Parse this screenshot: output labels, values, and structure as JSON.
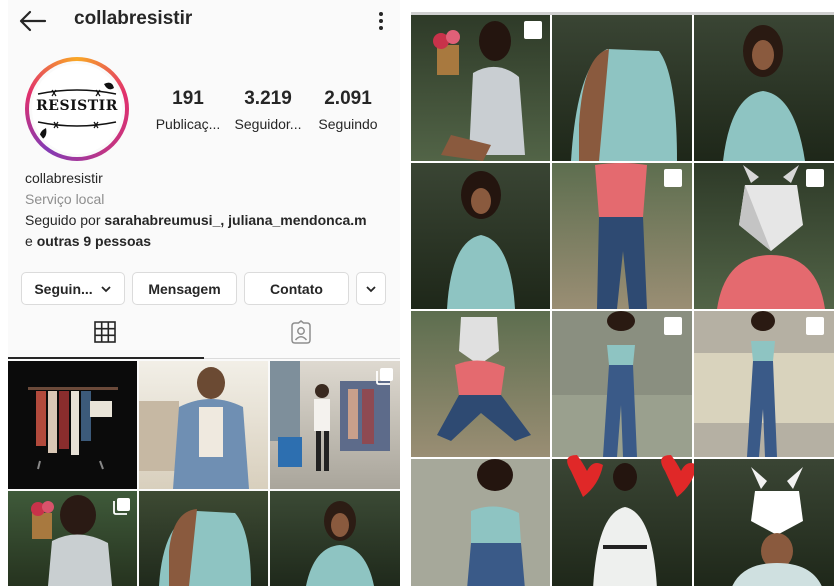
{
  "header": {
    "username": "collabresistir"
  },
  "profile": {
    "logo_text": "RESISTIR",
    "stats": [
      {
        "value": "191",
        "label": "Publicaç..."
      },
      {
        "value": "3.219",
        "label": "Seguidor..."
      },
      {
        "value": "2.091",
        "label": "Seguindo"
      }
    ],
    "name": "collabresistir",
    "category": "Serviço local",
    "followed_prefix": "Seguido por ",
    "followed_users": "sarahabreumusi_, juliana_mendonca.m",
    "followed_and": "e ",
    "followed_others": "outras 9 pessoas"
  },
  "actions": {
    "following_label": "Seguin...",
    "message_label": "Mensagem",
    "contact_label": "Contato"
  },
  "colors": {
    "text": "#262626",
    "muted": "#8e8e8e",
    "border": "#dbdbdb",
    "story_ring": "#e1306c"
  },
  "icons": {
    "back": "arrow-left-icon",
    "more": "vertical-dots-icon",
    "grid": "grid-icon",
    "tagged": "tagged-person-icon",
    "multi": "carousel-icon",
    "dropdown": "chevron-down-icon"
  }
}
